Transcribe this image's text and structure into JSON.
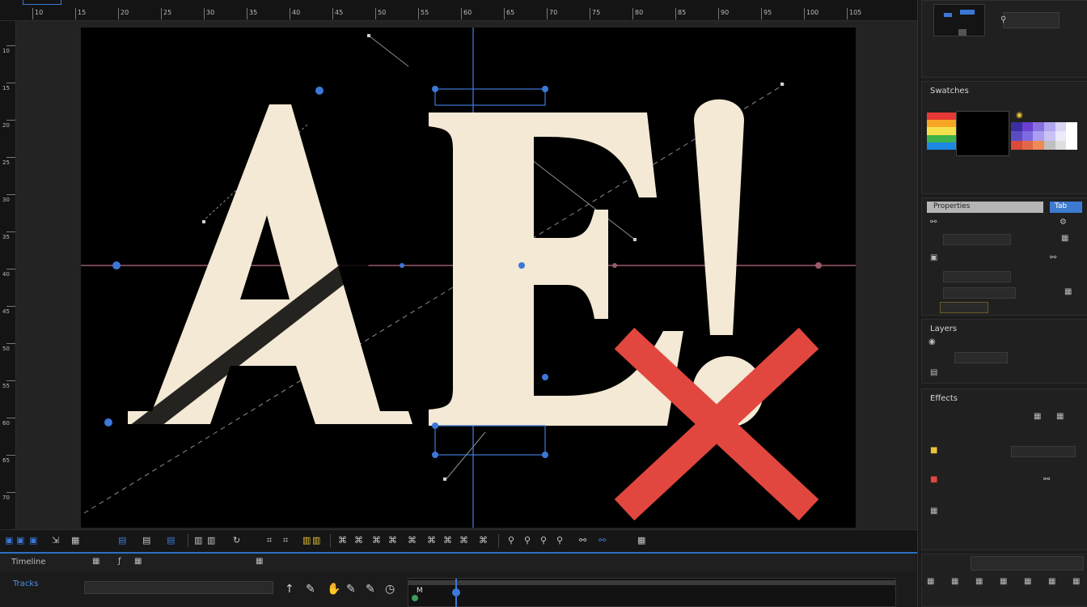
{
  "rulers": {
    "top_ticks": [
      "10",
      "15",
      "20",
      "25",
      "30",
      "35",
      "40",
      "45",
      "50",
      "55",
      "60",
      "65",
      "70",
      "75",
      "80",
      "85",
      "90",
      "95",
      "100",
      "105"
    ],
    "left_ticks": [
      "10",
      "15",
      "20",
      "25",
      "30",
      "35",
      "40",
      "45",
      "50",
      "55",
      "60",
      "65",
      "70"
    ]
  },
  "canvas": {
    "glyph_a": "A",
    "glyph_e": "E",
    "glyph_excl": "!",
    "letter_color": "#f3e9d4",
    "cross_color": "#e1473f",
    "guide_color": "#3c78d8",
    "baseline_color": "#9a5a6a"
  },
  "panels": {
    "swatches": {
      "title": "Swatches",
      "rainbow": [
        "#e53935",
        "#f6a623",
        "#f4e04d",
        "#3fb24b",
        "#1e88e5"
      ],
      "grid": [
        "#3a2ea0",
        "#6c3fd0",
        "#8a6fe0",
        "#b0a6f0",
        "#d8d4f6",
        "#ffffff",
        "#5b4cc4",
        "#7d6ae0",
        "#a99ef0",
        "#c9c2f4",
        "#ece9fb",
        "#ffffff",
        "#d94a3a",
        "#e2674a",
        "#ee8a58",
        "#bfbfbf",
        "#dedede",
        "#ffffff"
      ]
    },
    "properties": {
      "title": "Properties",
      "tab": "Tab"
    },
    "layers": {
      "title": "Layers"
    },
    "effects": {
      "title": "Effects"
    }
  },
  "timeline": {
    "title": "Timeline",
    "track_label": "Tracks",
    "marker_label": "M"
  }
}
